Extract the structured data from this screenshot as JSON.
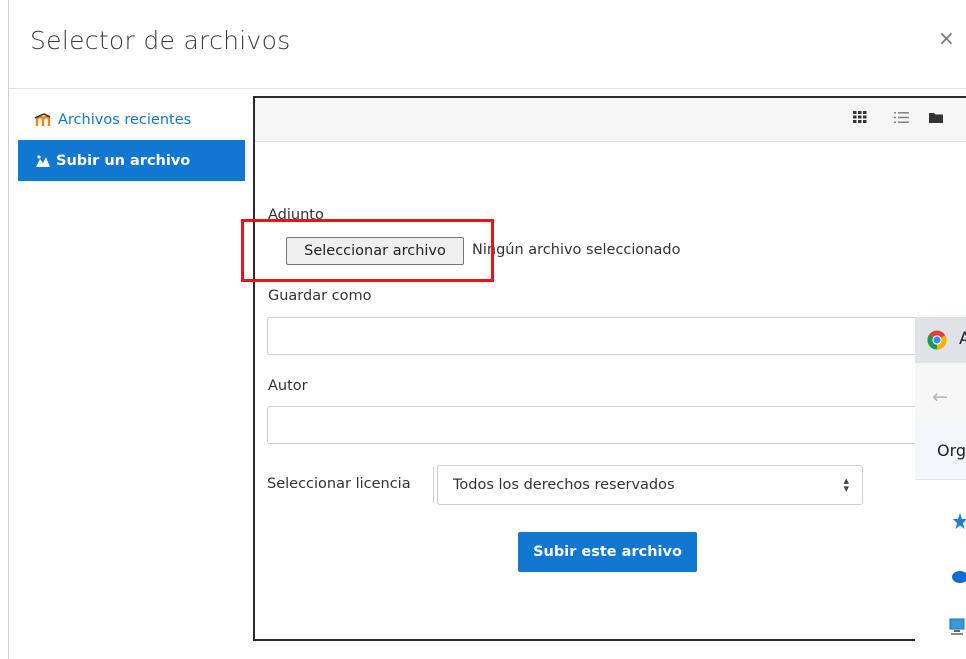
{
  "dialog": {
    "title": "Selector de archivos",
    "close_icon": "close-icon",
    "close_glyph": "×"
  },
  "sidebar": {
    "items": [
      {
        "label": "Archivos recientes",
        "icon": "moodle-logo-icon",
        "active": false
      },
      {
        "label": "Subir un archivo",
        "icon": "upload-icon",
        "active": true
      }
    ]
  },
  "toolbar": {
    "view_buttons": [
      "grid-view-icon",
      "list-view-icon",
      "folder-view-icon"
    ]
  },
  "form": {
    "attachment_label": "Adjunto",
    "file_button_label": "Seleccionar archivo",
    "file_status": "Ningún archivo seleccionado",
    "save_as_label": "Guardar como",
    "save_as_value": "",
    "author_label": "Autor",
    "author_value": "",
    "license_label": "Seleccionar licencia",
    "license_value": "Todos los derechos reservados",
    "submit_label": "Subir este archivo"
  },
  "overlay_window": {
    "title_fragment": "A",
    "menu_fragment": "Org",
    "back_icon": "back-arrow-icon",
    "app_icon": "chrome-icon",
    "sidebar_icons": [
      "quick-access-star-icon",
      "onedrive-cloud-icon",
      "this-pc-icon"
    ]
  },
  "colors": {
    "accent": "#1177d1",
    "highlight": "#e8141a",
    "panel_border": "#2b2b2b"
  }
}
